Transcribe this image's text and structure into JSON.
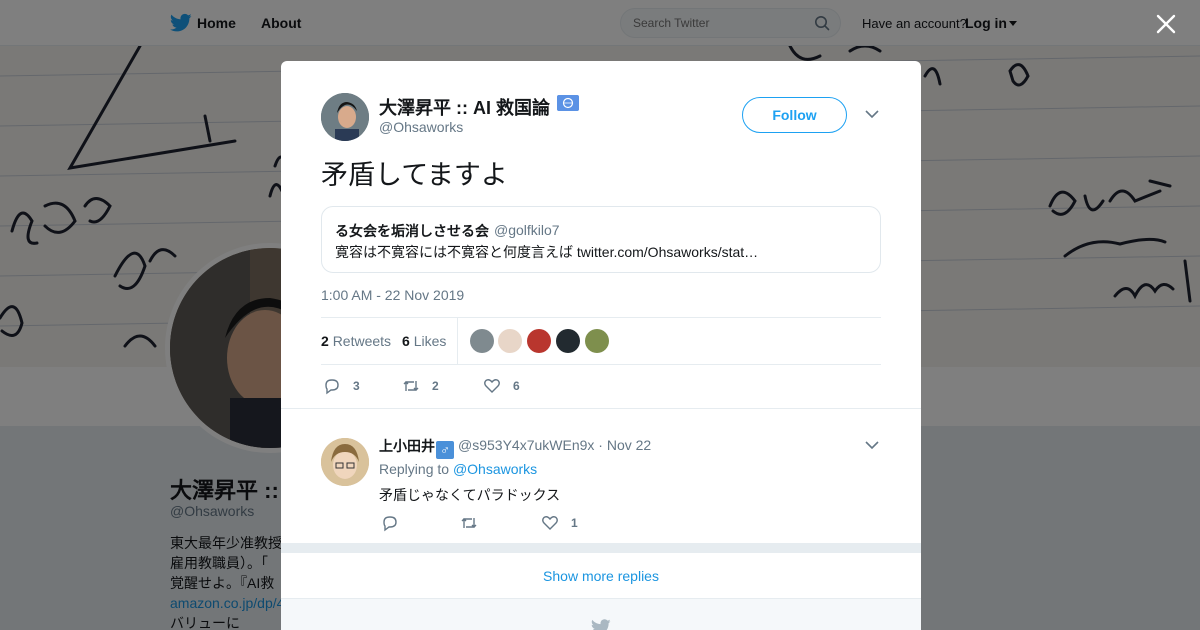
{
  "nav": {
    "home_label": "Home",
    "about_label": "About",
    "search_placeholder": "Search Twitter",
    "have_account": "Have an account?",
    "login_label": "Log in"
  },
  "background_profile": {
    "name": "大澤昇平 :: ",
    "handle": "@Ohsaworks",
    "bio_lines": [
      "東大最年少准教授",
      "雇用教職員）。「",
      "覚醒せよ。『AI救",
      "amazon.co.jp/dp/4",
      "バリューに"
    ]
  },
  "tweet": {
    "author_name": "大澤昇平 :: AI 救国論",
    "author_handle": "@Ohsaworks",
    "follow_label": "Follow",
    "text": "矛盾してますよ",
    "quote": {
      "author_name": "る女会を垢消しさせる会",
      "author_handle": "@golfkilo7",
      "text": "寛容は不寛容には不寛容と何度言えば twitter.com/Ohsaworks/stat…"
    },
    "timestamp": "1:00 AM - 22 Nov 2019",
    "retweets_count": "2",
    "retweets_label": "Retweets",
    "likes_count": "6",
    "likes_label": "Likes",
    "actions": {
      "replies": "3",
      "retweets": "2",
      "likes": "6"
    }
  },
  "reply": {
    "author_name": "上小田井",
    "author_emoji": "♂",
    "meta": "@s953Y4x7ukWEn9x · Nov 22",
    "replying_prefix": "Replying to",
    "replying_to": "@Ohsaworks",
    "text": "矛盾じゃなくてパラドックス",
    "actions": {
      "replies": "",
      "retweets": "",
      "likes": "1"
    }
  },
  "show_more_label": "Show more replies",
  "colors": {
    "accent": "#1da1f2",
    "link": "#1b95e0",
    "muted": "#657786",
    "text": "#14171a"
  }
}
